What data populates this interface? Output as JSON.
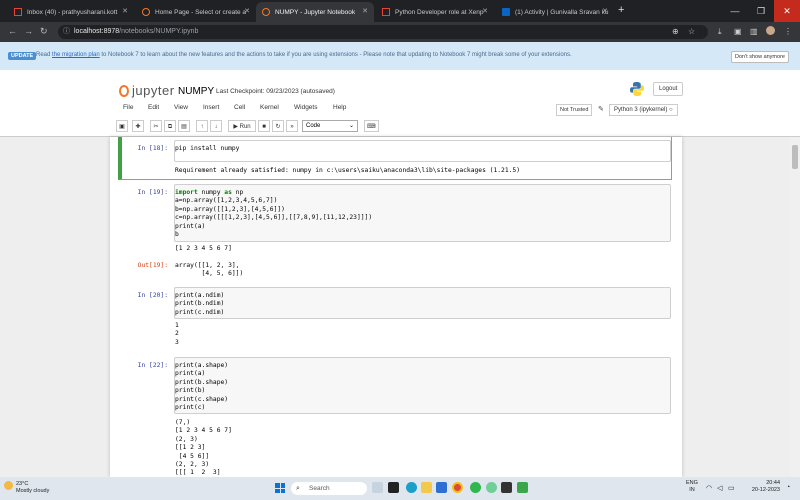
{
  "browser": {
    "tabs": [
      {
        "label": "Inbox (40) - prathyusharani.kott",
        "icon": "gmail-icon",
        "active": false
      },
      {
        "label": "Home Page - Select or create a",
        "icon": "jupyter-icon",
        "active": false
      },
      {
        "label": "NUMPY - Jupyter Notebook",
        "icon": "jupyter-icon",
        "active": true
      },
      {
        "label": "Python Developer role at Xenp",
        "icon": "gmail-icon",
        "active": false
      },
      {
        "label": "(1) Activity | Gunivalla Sravan ku",
        "icon": "linkedin-icon",
        "active": false
      }
    ],
    "url_host": "localhost:8978",
    "url_path": "/notebooks/NUMPY.ipynb"
  },
  "banner": {
    "badge": "UPDATE",
    "text_before": "Read ",
    "link": "the migration plan",
    "text_after": " to Notebook 7 to learn about the new features and the actions to take if you are using extensions - Please note that updating to Notebook 7 might break some of your extensions.",
    "dismiss": "Don't show anymore"
  },
  "header": {
    "logo_text": "jupyter",
    "notebook_name": "NUMPY",
    "checkpoint": "Last Checkpoint: 09/23/2023   (autosaved)",
    "logout": "Logout",
    "menus": [
      "File",
      "Edit",
      "View",
      "Insert",
      "Cell",
      "Kernel",
      "Widgets",
      "Help"
    ],
    "trusted": "Not Trusted",
    "kernel": "Python 3 (ipykernel)",
    "run_label": "Run",
    "cell_type": "Code"
  },
  "cells": {
    "c18": {
      "prompt": "In [18]:",
      "code": [
        "pip install numpy"
      ],
      "output": "Requirement already satisfied: numpy in c:\\users\\saiku\\anaconda3\\lib\\site-packages (1.21.5)"
    },
    "c19": {
      "prompt": "In [19]:",
      "code_kw": [
        "import",
        "as"
      ],
      "code_l1_a": "import",
      "code_l1_b": " numpy ",
      "code_l1_c": "as",
      "code_l1_d": " np",
      "code": [
        "a=np.array([1,2,3,4,5,6,7])",
        "b=np.array([[1,2,3],[4,5,6]])",
        "c=np.array([[[1,2,3],[4,5,6]],[[7,8,9],[11,12,23]]])",
        "print(a)",
        "b"
      ],
      "stdout": "[1 2 3 4 5 6 7]",
      "out_prompt": "Out[19]:",
      "out": "array([[1, 2, 3],\n       [4, 5, 6]])"
    },
    "c20": {
      "prompt": "In [20]:",
      "code": [
        "print(a.ndim)",
        "print(b.ndim)",
        "print(c.ndim)"
      ],
      "output": "1\n2\n3"
    },
    "c22": {
      "prompt": "In [22]:",
      "code": [
        "print(a.shape)",
        "print(a)",
        "print(b.shape)",
        "print(b)",
        "print(c.shape)",
        "print(c)"
      ],
      "output": "(7,)\n[1 2 3 4 5 6 7]\n(2, 3)\n[[1 2 3]\n [4 5 6]]\n(2, 2, 3)\n[[[ 1  2  3]"
    }
  },
  "taskbar": {
    "weather_temp": "23°C",
    "weather_desc": "Mostly cloudy",
    "search": "Search",
    "lang": "ENG",
    "region": "IN",
    "time": "20:44",
    "date": "20-12-2023"
  }
}
